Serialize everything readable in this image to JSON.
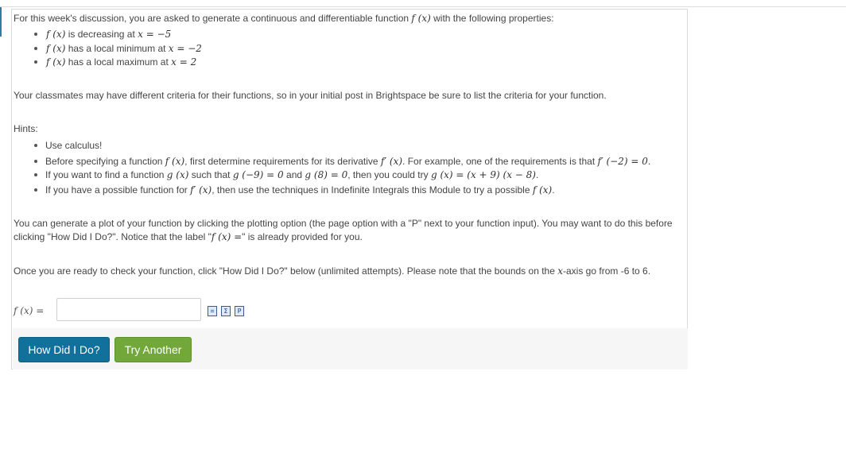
{
  "intro": {
    "text_a": "For this week's discussion, you are asked to generate a continuous and differentiable function",
    "fx": "f (x)",
    "text_b": "with the following properties:"
  },
  "properties": [
    {
      "fx": "f (x)",
      "text": "is decreasing at",
      "math": "x = −5"
    },
    {
      "fx": "f (x)",
      "text": "has a local minimum at",
      "math": "x = −2"
    },
    {
      "fx": "f (x)",
      "text": "has a local maximum at",
      "math": "x = 2"
    }
  ],
  "classmates_text": "Your classmates may have different criteria for their functions, so in your initial post in Brightspace be sure to list the criteria for your function.",
  "hints": {
    "label": "Hints:",
    "h1": "Use calculus!",
    "h2": {
      "a": "Before specifying a function",
      "fx": "f (x)",
      "b": ", first determine requirements for its derivative",
      "fpx": "f′ (x)",
      "c": ". For example, one of the requirements is that",
      "eq": "f′ (−2) = 0",
      "d": "."
    },
    "h3": {
      "a": "If you want to find a function",
      "gx": "g (x)",
      "b": "such that",
      "eq1": "g (−9) = 0",
      "c": "and",
      "eq2": "g (8) = 0",
      "d": ", then you could try",
      "eq3": "g (x) = (x + 9) (x − 8)",
      "e": "."
    },
    "h4": {
      "a": "If you have a possible function for",
      "fpx": "f′ (x)",
      "b": ", then use the techniques in Indefinite Integrals this Module to try a possible",
      "fx": "f (x)",
      "c": "."
    }
  },
  "plot_text": {
    "line1": "You can generate a plot of your function by clicking the plotting option (the page option with a \"P\" next to your function input). You may want to do this before",
    "line2a": "clicking \"How Did I Do?\". Notice that the label \"",
    "line2fx": "f (x) =",
    "line2b": "\" is already provided for you."
  },
  "ready_text": {
    "a": "Once you are ready to check your function, click \"How Did I Do?\" below (unlimited attempts). Please note that the bounds on the",
    "x": "x",
    "b": "-axis go from -6 to 6."
  },
  "answer": {
    "label": "f (x) =",
    "value": "",
    "tools": [
      {
        "icon": "calculator-icon",
        "glyph": "⌗"
      },
      {
        "icon": "sigma-icon",
        "glyph": "Σ"
      },
      {
        "icon": "plot-icon",
        "glyph": "P"
      }
    ]
  },
  "buttons": {
    "how": "How Did I Do?",
    "try": "Try Another"
  },
  "colors": {
    "how_button": "#11719a",
    "try_button": "#72a73a"
  }
}
